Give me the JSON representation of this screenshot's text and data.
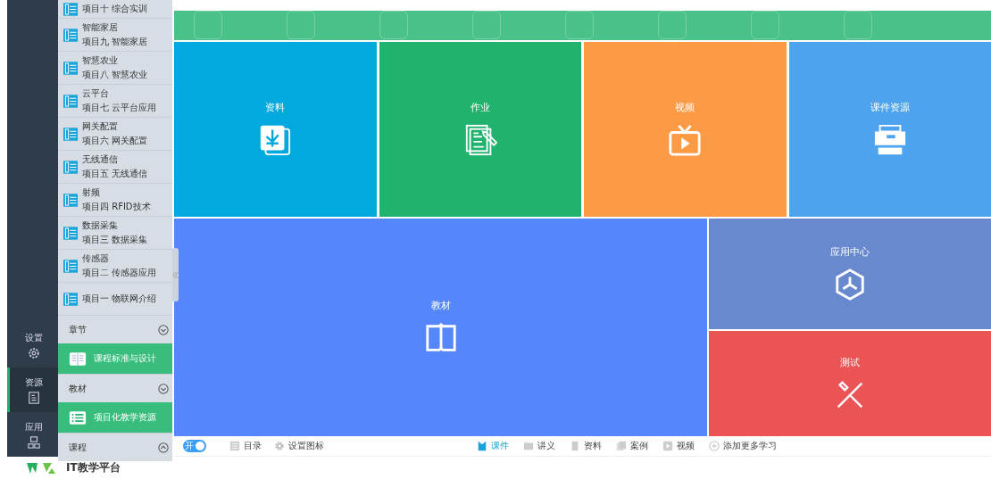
{
  "rail": [
    {
      "label": "设置",
      "kind": "gear",
      "selected": false
    },
    {
      "label": "资源",
      "kind": "doc",
      "selected": true
    },
    {
      "label": "应用",
      "kind": "apps",
      "selected": false
    }
  ],
  "sidebar": [
    {
      "kind": "project",
      "title": "项目十 综合实训"
    },
    {
      "kind": "project",
      "subtitle": "智能家居",
      "title": "项目九 智能家居"
    },
    {
      "kind": "project",
      "subtitle": "智慧农业",
      "title": "项目八 智慧农业"
    },
    {
      "kind": "project",
      "subtitle": "云平台",
      "title": "项目七 云平台应用"
    },
    {
      "kind": "project",
      "subtitle": "网关配置",
      "title": "项目六 网关配置"
    },
    {
      "kind": "project",
      "subtitle": "无线通信",
      "title": "项目五 无线通信"
    },
    {
      "kind": "project",
      "subtitle": "射频",
      "title": "项目四 RFID技术"
    },
    {
      "kind": "project",
      "subtitle": "数据采集",
      "title": "项目三 数据采集"
    },
    {
      "kind": "project",
      "subtitle": "传感器",
      "title": "项目二 传感器应用"
    },
    {
      "kind": "project",
      "title": "项目一 物联网介绍"
    },
    {
      "kind": "header",
      "title": "章节",
      "expanded": true
    },
    {
      "kind": "feature_book",
      "title": "课程标准与设计"
    },
    {
      "kind": "header",
      "title": "教材",
      "expanded": true
    },
    {
      "kind": "feature_list",
      "title": "项目化教学资源"
    },
    {
      "kind": "header",
      "title": "课程",
      "expanded": false
    }
  ],
  "tiles": [
    {
      "label": "资料",
      "kind": "text",
      "color": "#02a9de"
    },
    {
      "label": "作业",
      "kind": "edit",
      "color": "#21b36e"
    },
    {
      "label": "视频",
      "kind": "tv",
      "color": "#fd9a45"
    },
    {
      "label": "课件资源",
      "kind": "printer",
      "color": "#4ea3ee"
    },
    {
      "label": "教材",
      "kind": "book",
      "color": "#5586fc"
    },
    {
      "label": "应用中心",
      "kind": "cube",
      "color": "#6889cd"
    },
    {
      "label": "测试",
      "kind": "tools",
      "color": "#eb5455"
    }
  ],
  "toolbar": {
    "toggle": {
      "label": "开",
      "on": true
    },
    "left_items": [
      {
        "label": "目录",
        "kind": "list"
      },
      {
        "label": "设置图标",
        "kind": "gear"
      }
    ],
    "tabs": [
      {
        "label": "课件",
        "kind": "bookmark",
        "selected": true
      },
      {
        "label": "讲义",
        "kind": "note",
        "selected": false
      },
      {
        "label": "资料",
        "kind": "file",
        "selected": false
      },
      {
        "label": "案例",
        "kind": "pages",
        "selected": false
      },
      {
        "label": "视频",
        "kind": "play",
        "selected": false
      },
      {
        "label": "添加更多学习",
        "kind": "add",
        "selected": false
      }
    ]
  },
  "header": {
    "title": "IT教学平台"
  }
}
